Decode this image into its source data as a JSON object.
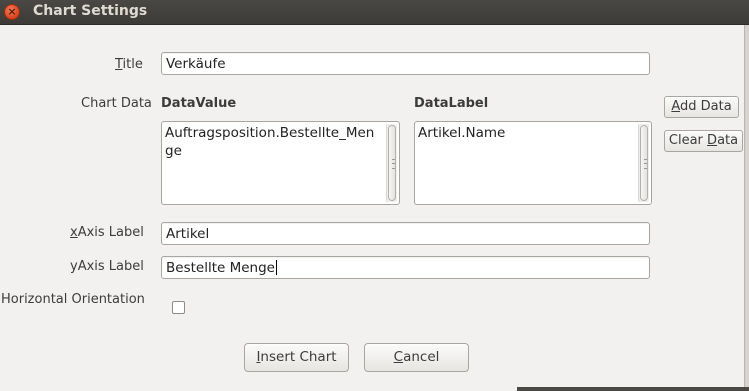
{
  "window": {
    "title": "Chart Settings",
    "close_symbol": "×"
  },
  "form": {
    "title": {
      "label": "Title",
      "mnemonic": "T",
      "label_rest": "itle",
      "value": "Verkäufe"
    },
    "chart_data": {
      "label": "Chart Data",
      "data_value_header": "DataValue",
      "data_label_header": "DataLabel",
      "data_value_text": "Auftragsposition.Bestellte_Menge",
      "data_label_text": "Artikel.Name"
    },
    "x_axis": {
      "label": "xAxis Label",
      "mnemonic": "x",
      "label_rest": "Axis Label",
      "value": "Artikel"
    },
    "y_axis": {
      "label": "yAxis Label",
      "value": "Bestellte Menge"
    },
    "horizontal_orientation": {
      "label": "Horizontal Orientation",
      "checked": false
    }
  },
  "buttons": {
    "add_data": {
      "label": "Add Data",
      "mnemonic": "A",
      "label_rest": "dd Data"
    },
    "clear_data": {
      "label": "Clear Data",
      "pre": "Clear ",
      "mnemonic": "D",
      "label_rest": "ata"
    },
    "insert_chart": {
      "label": "Insert Chart",
      "mnemonic": "I",
      "label_rest": "nsert Chart"
    },
    "cancel": {
      "label": "Cancel",
      "mnemonic": "C",
      "label_rest": "ancel"
    }
  },
  "icons": {
    "close": "close-icon",
    "scroll_thumb": "scroll-grip-icon"
  },
  "colors": {
    "titlebar": "#3c3b37",
    "close_button": "#e05a2b",
    "dialog_background": "#f2f1f0"
  }
}
